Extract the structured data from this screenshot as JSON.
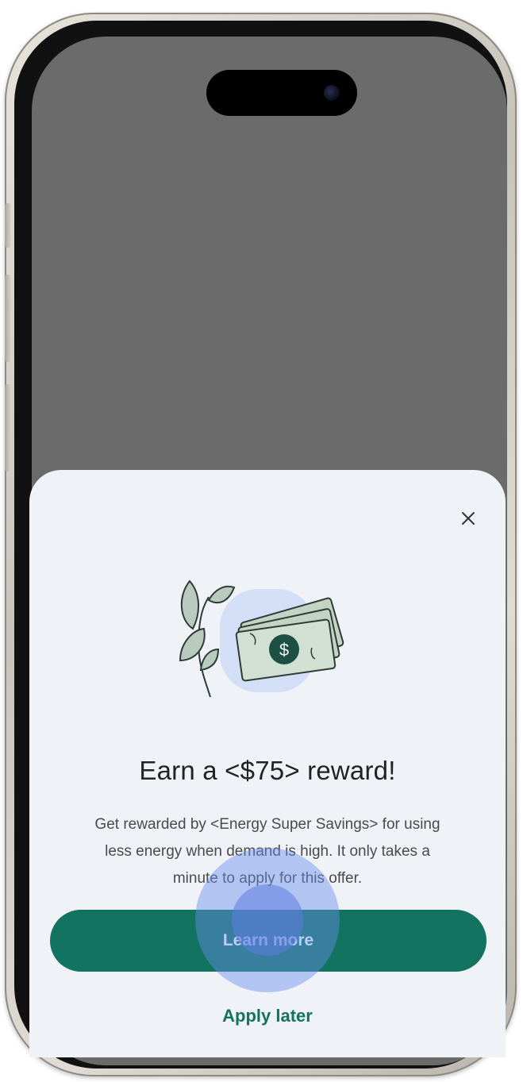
{
  "sheet": {
    "close_glyph": "✕",
    "title": "Earn a <$75> reward!",
    "body_line_1": "Get rewarded by <Energy Super Savings>  for using",
    "body_line_2": "less energy when demand is high. It only takes a",
    "body_line_3": "minute to apply for this offer.",
    "primary_button": "Learn more",
    "secondary_link": "Apply later",
    "illustration_currency_glyph": "$"
  },
  "icons": {
    "close": "close-icon",
    "illustration": "money-and-leaf-illustration",
    "leaf": "leaf-icon",
    "cash": "cash-icon"
  },
  "colors": {
    "primary": "#127360",
    "screen_dim": "#6b6b6b",
    "sheet_bg": "#eff2f6",
    "illustration_highlight": "#d3dff7",
    "touch_indicator": "#6a8ceb"
  }
}
